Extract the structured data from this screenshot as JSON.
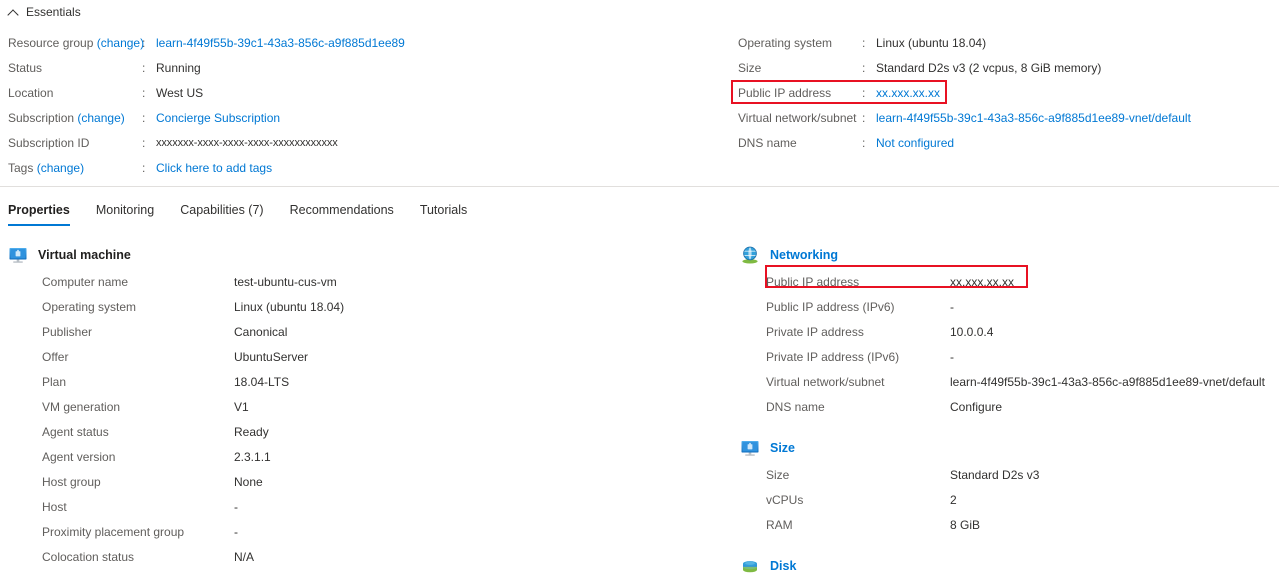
{
  "essentials": {
    "title": "Essentials",
    "collapse_icon": "chevron-up-icon",
    "left_rows": [
      {
        "label": "Resource group",
        "change": "(change)",
        "colon": ":",
        "value": "learn-4f49f55b-39c1-43a3-856c-a9f885d1ee89",
        "style": "link"
      },
      {
        "label": "Status",
        "change": "",
        "colon": ":",
        "value": "Running",
        "style": "text"
      },
      {
        "label": "Location",
        "change": "",
        "colon": ":",
        "value": "West US",
        "style": "text"
      },
      {
        "label": "Subscription",
        "change": "(change)",
        "colon": ":",
        "value": "Concierge Subscription",
        "style": "link"
      },
      {
        "label": "Subscription ID",
        "change": "",
        "colon": ":",
        "value": "xxxxxxx-xxxx-xxxx-xxxx-xxxxxxxxxxxx",
        "style": "mono"
      },
      {
        "label": "Tags",
        "change": "(change)",
        "colon": ":",
        "value": "Click here to add tags",
        "style": "link"
      }
    ],
    "right_rows": [
      {
        "label": "Operating system",
        "colon": ":",
        "value": "Linux (ubuntu 18.04)",
        "style": "text"
      },
      {
        "label": "Size",
        "colon": ":",
        "value": "Standard D2s v3 (2 vcpus, 8 GiB memory)",
        "style": "text"
      },
      {
        "label": "Public IP address",
        "colon": ":",
        "value": "xx.xxx.xx.xx",
        "style": "link"
      },
      {
        "label": "Virtual network/subnet",
        "colon": ":",
        "value": "learn-4f49f55b-39c1-43a3-856c-a9f885d1ee89-vnet/default",
        "style": "link"
      },
      {
        "label": "DNS name",
        "colon": ":",
        "value": "Not configured",
        "style": "link"
      }
    ]
  },
  "tabs": [
    {
      "label": "Properties",
      "active": true
    },
    {
      "label": "Monitoring",
      "active": false
    },
    {
      "label": "Capabilities (7)",
      "active": false
    },
    {
      "label": "Recommendations",
      "active": false
    },
    {
      "label": "Tutorials",
      "active": false
    }
  ],
  "panels_left": [
    {
      "title": "Virtual machine",
      "icon": "virtual-machine-icon",
      "title_style": "plain",
      "rows": [
        {
          "label": "Computer name",
          "value": "test-ubuntu-cus-vm",
          "style": "text"
        },
        {
          "label": "Operating system",
          "value": "Linux (ubuntu 18.04)",
          "style": "text"
        },
        {
          "label": "Publisher",
          "value": "Canonical",
          "style": "text"
        },
        {
          "label": "Offer",
          "value": "UbuntuServer",
          "style": "text"
        },
        {
          "label": "Plan",
          "value": "18.04-LTS",
          "style": "text"
        },
        {
          "label": "VM generation",
          "value": "V1",
          "style": "text"
        },
        {
          "label": "Agent status",
          "value": "Ready",
          "style": "text"
        },
        {
          "label": "Agent version",
          "value": "2.3.1.1",
          "style": "text"
        },
        {
          "label": "Host group",
          "value": "None",
          "style": "link"
        },
        {
          "label": "Host",
          "value": "-",
          "style": "text"
        },
        {
          "label": "Proximity placement group",
          "value": "-",
          "style": "text"
        },
        {
          "label": "Colocation status",
          "value": "N/A",
          "style": "text"
        }
      ]
    }
  ],
  "panels_right": [
    {
      "title": "Networking",
      "icon": "globe-network-icon",
      "title_style": "link",
      "rows": [
        {
          "label": "Public IP address",
          "value": "xx.xxx.xx.xx",
          "style": "link"
        },
        {
          "label": "Public IP address (IPv6)",
          "value": "-",
          "style": "text"
        },
        {
          "label": "Private IP address",
          "value": "10.0.0.4",
          "style": "text"
        },
        {
          "label": "Private IP address (IPv6)",
          "value": "-",
          "style": "text"
        },
        {
          "label": "Virtual network/subnet",
          "value": "learn-4f49f55b-39c1-43a3-856c-a9f885d1ee89-vnet/default",
          "style": "link"
        },
        {
          "label": "DNS name",
          "value": "Configure",
          "style": "link"
        }
      ]
    },
    {
      "title": "Size",
      "icon": "size-monitor-icon",
      "title_style": "link",
      "rows": [
        {
          "label": "Size",
          "value": "Standard D2s v3",
          "style": "text"
        },
        {
          "label": "vCPUs",
          "value": "2",
          "style": "text"
        },
        {
          "label": "RAM",
          "value": "8 GiB",
          "style": "text"
        }
      ]
    },
    {
      "title": "Disk",
      "icon": "disk-stack-icon",
      "title_style": "link",
      "rows": []
    }
  ],
  "highlights": [
    {
      "name": "redbox-essentials-pip",
      "color": "#e81123"
    },
    {
      "name": "redbox-networking-pip",
      "color": "#e81123"
    }
  ],
  "colors": {
    "accent": "#0078d4",
    "link": "#0078d4",
    "label": "#605e5c",
    "value": "#323130",
    "highlight": "#e81123",
    "divider": "#e1dfdd"
  }
}
